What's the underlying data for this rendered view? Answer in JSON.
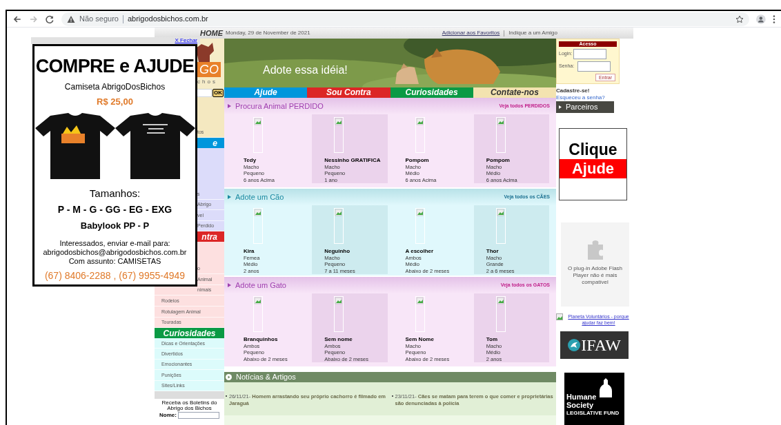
{
  "browser": {
    "security": "Não seguro",
    "url": "abrigodosbichos.com.br"
  },
  "topbar": {
    "home": "HOME",
    "date": "Monday, 29  de November de 2021",
    "links": [
      "Adicionar aos Favoritos",
      "Indique a um Amigo"
    ]
  },
  "logo": {
    "text": "GO",
    "subtext": "chos"
  },
  "search": {
    "button": "OK"
  },
  "banner": {
    "caption": "Adote essa idéia!"
  },
  "nav": [
    {
      "label": "Ajude",
      "color": "#0096dc"
    },
    {
      "label": "Sou Contra",
      "color": "#dc2626"
    },
    {
      "label": "Curiosidades",
      "color": "#0a9a44"
    },
    {
      "label": "Contate-nos",
      "color": "#f3e3b0"
    }
  ],
  "login": {
    "title": "Acesso",
    "fields": [
      {
        "label": "Login:"
      },
      {
        "label": "Senha:"
      }
    ],
    "button": "Entrar",
    "register": "Cadastre-se!",
    "forgot": "Esqueceu a senha?"
  },
  "sidebar": [
    {
      "kind": "beige",
      "items": [
        "tos"
      ]
    },
    {
      "kind": "ajude",
      "header": "e",
      "items": [
        "s",
        "Abrigo",
        "vel",
        "Perdido"
      ]
    },
    {
      "kind": "contra",
      "header": "ntra",
      "items": [
        "o",
        "Animal",
        "nimais"
      ]
    },
    {
      "kind": "contra_more",
      "items": [
        "Rodeios",
        "Rotulagem Animal",
        "Touradas"
      ]
    },
    {
      "kind": "curiosidades",
      "header": "Curiosidades",
      "items": [
        "Dicas e Orientações",
        "Divertidos",
        "Emocionantes",
        "Punições",
        "Sites/Links"
      ]
    }
  ],
  "newsletter": {
    "text": "Receba os Boletins do Abrigo dos Bichos",
    "label": "Nome:"
  },
  "sections": [
    {
      "kind": "lost",
      "title": "Procura Animal PERDIDO",
      "link": "Veja todos PERDIDOS",
      "cards": [
        {
          "name": "Tedy",
          "lines": [
            "Macho",
            "Pequeno",
            "6 anos Acima"
          ]
        },
        {
          "name": "Nessinho GRATIFICA",
          "lines": [
            "Macho",
            "Pequeno",
            "1 ano"
          ]
        },
        {
          "name": "Pompom",
          "lines": [
            "Macho",
            "Médio",
            "6 anos Acima"
          ]
        },
        {
          "name": "Pompom",
          "lines": [
            "Macho",
            "Médio",
            "6 anos Acima"
          ]
        }
      ]
    },
    {
      "kind": "dogs",
      "title": "Adote um Cão",
      "link": "Veja todos os CÃES",
      "cards": [
        {
          "name": "Kira",
          "lines": [
            "Femea",
            "Médio",
            "2 anos"
          ]
        },
        {
          "name": "Neguinho",
          "lines": [
            "Macho",
            "Pequeno",
            "7 a 11 meses"
          ]
        },
        {
          "name": "A escolher",
          "lines": [
            "Ambos",
            "Médio",
            "Abaixo de 2 meses"
          ]
        },
        {
          "name": "Thor",
          "lines": [
            "Macho",
            "Grande",
            "2 a 6 meses"
          ]
        }
      ]
    },
    {
      "kind": "cats",
      "title": "Adote um Gato",
      "link": "Veja todos os GATOS",
      "cards": [
        {
          "name": "Branquinhos",
          "lines": [
            "Ambos",
            "Pequeno",
            "Abaixo de 2 meses"
          ]
        },
        {
          "name": "Sem nome",
          "lines": [
            "Ambos",
            "Pequeno",
            "Abaixo de 2 meses"
          ]
        },
        {
          "name": "Sem Nome",
          "lines": [
            "Macho",
            "Pequeno",
            "Abaixo de 2 meses"
          ]
        },
        {
          "name": "Tom",
          "lines": [
            "Macho",
            "Médio",
            "2 anos"
          ]
        }
      ]
    }
  ],
  "news": {
    "title": "Notícias & Artigos",
    "items": [
      {
        "date": "26/11/21-",
        "title": "Homem arrastando seu próprio cachorro é filmado em Jaraguá"
      },
      {
        "date": "23/11/21-",
        "title": "Cães se matam para terem o que comer e proprietárias são denunciadas à polícia"
      }
    ]
  },
  "partners": {
    "title": "Parceiros",
    "ad": [
      "Clique",
      "Ajude"
    ],
    "flash": "O plug-in Adobe Flash Player não é mais compatível",
    "link": "Planeta Voluntários - porque ajudar faz bem!",
    "ifaw": "IFAW",
    "humane": [
      "Humane",
      "Society",
      "LEGISLATIVE FUND"
    ]
  },
  "popup": {
    "close": "X Fechar",
    "heading": "COMPRE e AJUDE",
    "product": "Camiseta AbrigoDosBichos",
    "price": "R$ 25,00",
    "sizes_label": "Tamanhos:",
    "sizes": "P - M - G - GG - EG - EXG",
    "babylook": "Babylook PP - P",
    "contact": [
      "Interessados, enviar e-mail para:",
      "abrigodosbichos@abrigodosbichos.com.br",
      "Com assunto: CAMISETAS"
    ],
    "phones": "(67) 8406-2288 , (67) 9955-4949"
  }
}
